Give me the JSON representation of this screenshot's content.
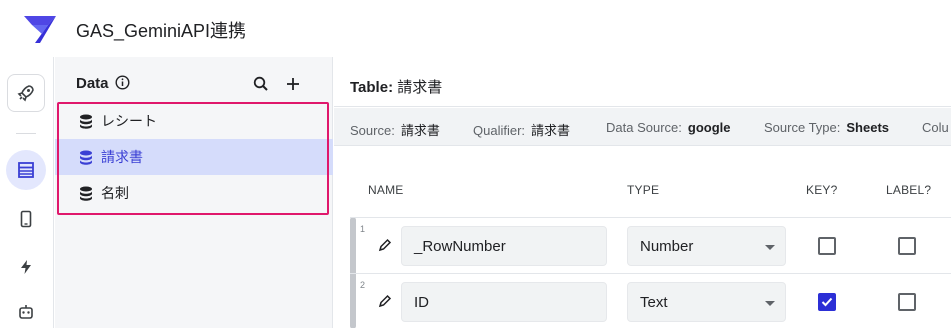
{
  "app": {
    "title": "GAS_GeminiAPI連携"
  },
  "rail": {
    "items": [
      "launch",
      "data",
      "views",
      "automation",
      "bots"
    ]
  },
  "data_panel": {
    "title": "Data",
    "tables": [
      {
        "label": "レシート",
        "selected": false
      },
      {
        "label": "請求書",
        "selected": true
      },
      {
        "label": "名刺",
        "selected": false
      }
    ]
  },
  "main": {
    "title_prefix": "Table:",
    "title_name": "請求書",
    "meta": {
      "source_label": "Source:",
      "source_value": "請求書",
      "qualifier_label": "Qualifier:",
      "qualifier_value": "請求書",
      "datasource_label": "Data Source:",
      "datasource_value": "google",
      "sourcetype_label": "Source Type:",
      "sourcetype_value": "Sheets",
      "cols_label": "Colu"
    },
    "columns": {
      "name": "NAME",
      "type": "TYPE",
      "key": "KEY?",
      "label": "LABEL?"
    },
    "rows": [
      {
        "num": "1",
        "name": "_RowNumber",
        "type": "Number",
        "key": false,
        "label": false
      },
      {
        "num": "2",
        "name": "ID",
        "type": "Text",
        "key": true,
        "label": false
      }
    ]
  },
  "colors": {
    "accent": "#2c2fd6",
    "highlight_border": "#e0186c",
    "selected_bg": "#d5dcfb"
  }
}
